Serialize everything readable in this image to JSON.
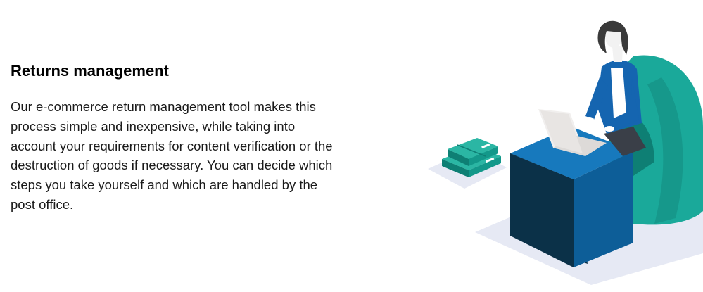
{
  "section": {
    "heading": "Returns management",
    "paragraph": "Our e-commerce return management tool makes this process simple and inexpensive, while taking into account your requirements for content verification or the destruction of goods if necessary. You can decide which steps you take yourself and which are handled by the post office."
  },
  "illustration": {
    "icon": "woman-at-laptop-with-parcels-illustration",
    "colors": {
      "teal": "#1aa99a",
      "dark_teal": "#0e7f74",
      "desk_blue": "#0d6aa8",
      "desk_dark": "#0b3148",
      "jacket_blue": "#1565b0",
      "floor": "#e6e9f4"
    }
  }
}
